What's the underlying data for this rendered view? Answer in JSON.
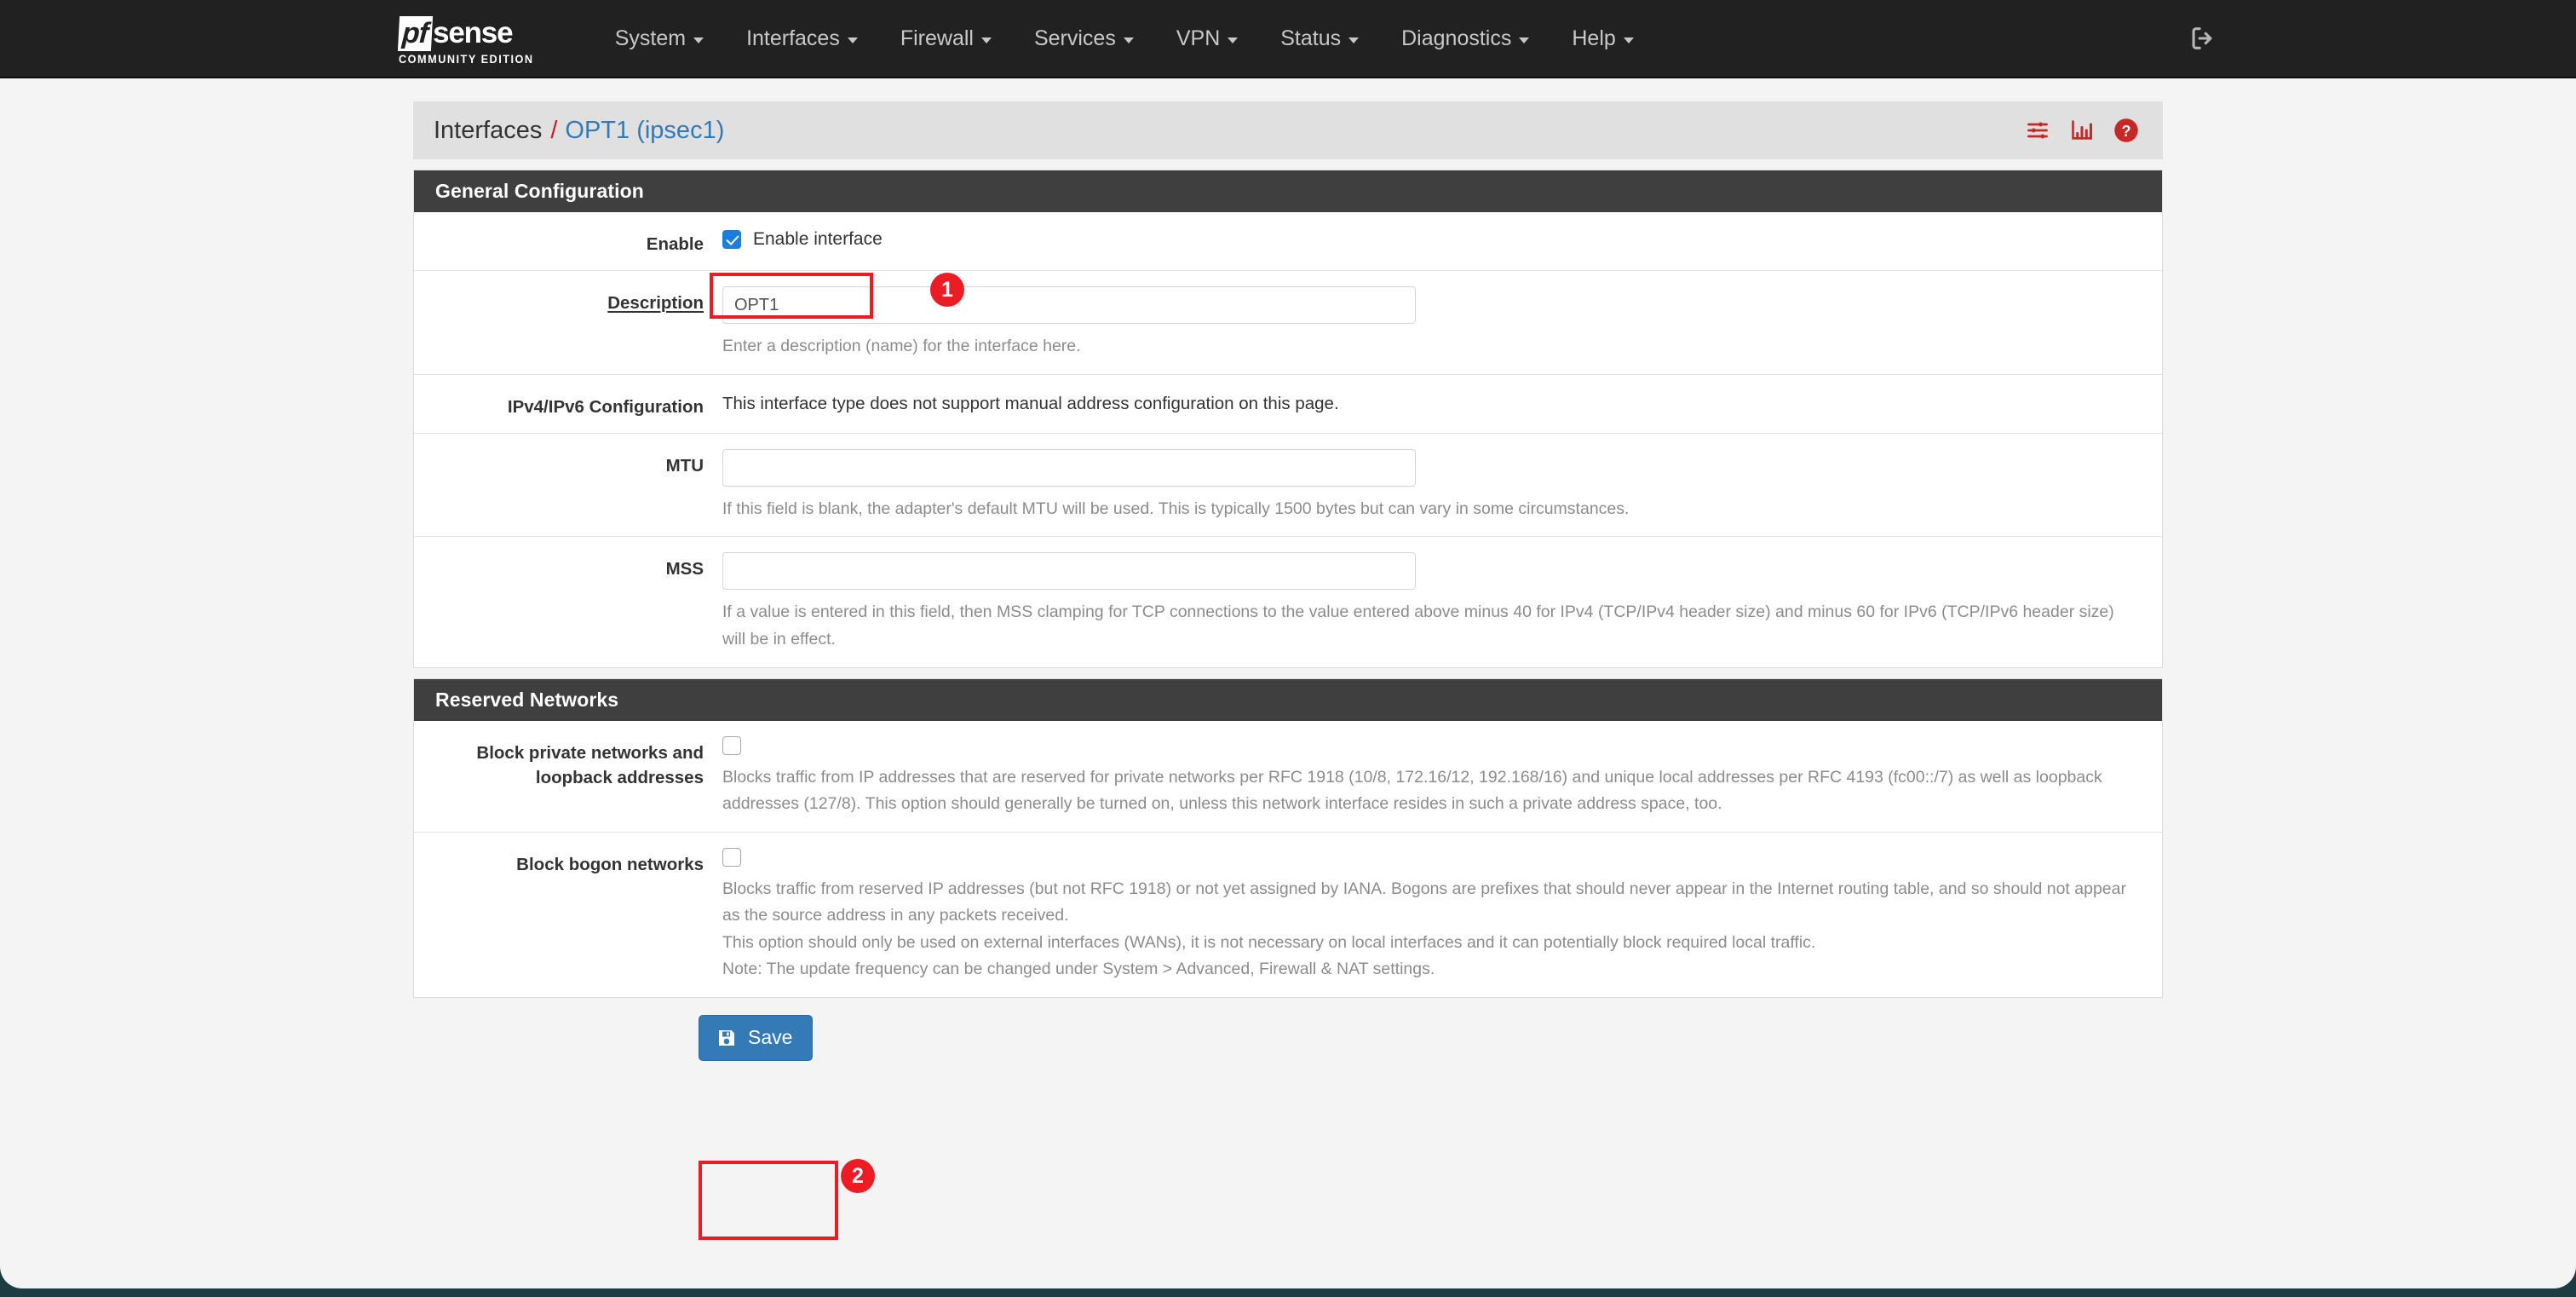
{
  "navbar": {
    "brand": {
      "logo_mark": "pf",
      "logo_text": "sense",
      "subtitle": "COMMUNITY EDITION"
    },
    "items": [
      {
        "label": "System",
        "icon": "chevron-down-icon"
      },
      {
        "label": "Interfaces",
        "icon": "chevron-down-icon"
      },
      {
        "label": "Firewall",
        "icon": "chevron-down-icon"
      },
      {
        "label": "Services",
        "icon": "chevron-down-icon"
      },
      {
        "label": "VPN",
        "icon": "chevron-down-icon"
      },
      {
        "label": "Status",
        "icon": "chevron-down-icon"
      },
      {
        "label": "Diagnostics",
        "icon": "chevron-down-icon"
      },
      {
        "label": "Help",
        "icon": "chevron-down-icon"
      }
    ],
    "logout_icon": "logout-icon"
  },
  "breadcrumb": {
    "parent": "Interfaces",
    "separator": "/",
    "current": "OPT1 (ipsec1)",
    "icons": [
      {
        "name": "sliders-icon"
      },
      {
        "name": "bar-chart-icon"
      },
      {
        "name": "help-circle-icon"
      }
    ]
  },
  "general_configuration": {
    "heading": "General Configuration",
    "enable": {
      "label": "Enable",
      "checkbox_label": "Enable interface",
      "checked": true
    },
    "description": {
      "label": "Description",
      "value": "OPT1",
      "help": "Enter a description (name) for the interface here."
    },
    "ip_configuration": {
      "label": "IPv4/IPv6 Configuration",
      "text": "This interface type does not support manual address configuration on this page."
    },
    "mtu": {
      "label": "MTU",
      "value": "",
      "help": "If this field is blank, the adapter's default MTU will be used. This is typically 1500 bytes but can vary in some circumstances."
    },
    "mss": {
      "label": "MSS",
      "value": "",
      "help": "If a value is entered in this field, then MSS clamping for TCP connections to the value entered above minus 40 for IPv4 (TCP/IPv4 header size) and minus 60 for IPv6 (TCP/IPv6 header size) will be in effect."
    }
  },
  "reserved_networks": {
    "heading": "Reserved Networks",
    "block_private": {
      "label": "Block private networks and loopback addresses",
      "checked": false,
      "help": "Blocks traffic from IP addresses that are reserved for private networks per RFC 1918 (10/8, 172.16/12, 192.168/16) and unique local addresses per RFC 4193 (fc00::/7) as well as loopback addresses (127/8). This option should generally be turned on, unless this network interface resides in such a private address space, too."
    },
    "block_bogon": {
      "label": "Block bogon networks",
      "checked": false,
      "help_line1": "Blocks traffic from reserved IP addresses (but not RFC 1918) or not yet assigned by IANA. Bogons are prefixes that should never appear in the Internet routing table, and so should not appear as the source address in any packets received.",
      "help_line2": "This option should only be used on external interfaces (WANs), it is not necessary on local interfaces and it can potentially block required local traffic.",
      "help_line3": "Note: The update frequency can be changed under System > Advanced, Firewall & NAT settings."
    }
  },
  "actions": {
    "save_label": "Save",
    "save_icon": "save-floppy-icon"
  },
  "annotations": [
    {
      "id": 1,
      "badge": "1",
      "target": "enable-interface-checkbox"
    },
    {
      "id": 2,
      "badge": "2",
      "target": "save-button"
    }
  ],
  "colors": {
    "navbar_bg": "#212121",
    "panel_heading_bg": "#3f3f3f",
    "accent_link": "#337ab7",
    "breadcrumb_separator": "#d01a1a",
    "icon_red": "#c62828",
    "annotation_red": "#ed1c24",
    "checkbox_checked": "#1a7ee0"
  }
}
